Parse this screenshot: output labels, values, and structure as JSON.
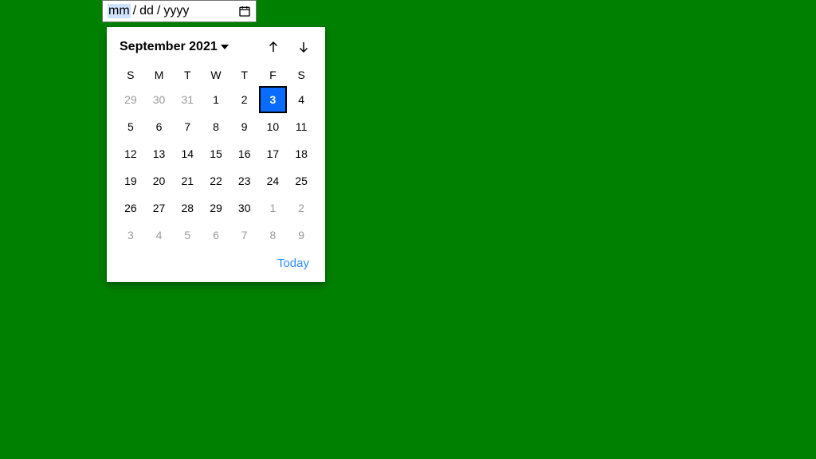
{
  "input": {
    "mm": "mm",
    "sep": "/",
    "dd": "dd",
    "yyyy": "yyyy"
  },
  "picker": {
    "month_year": "September 2021",
    "day_headers": [
      "S",
      "M",
      "T",
      "W",
      "T",
      "F",
      "S"
    ],
    "weeks": [
      [
        {
          "d": "29",
          "other": true
        },
        {
          "d": "30",
          "other": true
        },
        {
          "d": "31",
          "other": true
        },
        {
          "d": "1"
        },
        {
          "d": "2"
        },
        {
          "d": "3",
          "selected": true
        },
        {
          "d": "4"
        }
      ],
      [
        {
          "d": "5"
        },
        {
          "d": "6"
        },
        {
          "d": "7"
        },
        {
          "d": "8"
        },
        {
          "d": "9"
        },
        {
          "d": "10"
        },
        {
          "d": "11"
        }
      ],
      [
        {
          "d": "12"
        },
        {
          "d": "13"
        },
        {
          "d": "14"
        },
        {
          "d": "15"
        },
        {
          "d": "16"
        },
        {
          "d": "17"
        },
        {
          "d": "18"
        }
      ],
      [
        {
          "d": "19"
        },
        {
          "d": "20"
        },
        {
          "d": "21"
        },
        {
          "d": "22"
        },
        {
          "d": "23"
        },
        {
          "d": "24"
        },
        {
          "d": "25"
        }
      ],
      [
        {
          "d": "26"
        },
        {
          "d": "27"
        },
        {
          "d": "28"
        },
        {
          "d": "29"
        },
        {
          "d": "30"
        },
        {
          "d": "1",
          "other": true
        },
        {
          "d": "2",
          "other": true
        }
      ],
      [
        {
          "d": "3",
          "other": true
        },
        {
          "d": "4",
          "other": true
        },
        {
          "d": "5",
          "other": true
        },
        {
          "d": "6",
          "other": true
        },
        {
          "d": "7",
          "other": true
        },
        {
          "d": "8",
          "other": true
        },
        {
          "d": "9",
          "other": true
        }
      ]
    ],
    "today_label": "Today"
  }
}
